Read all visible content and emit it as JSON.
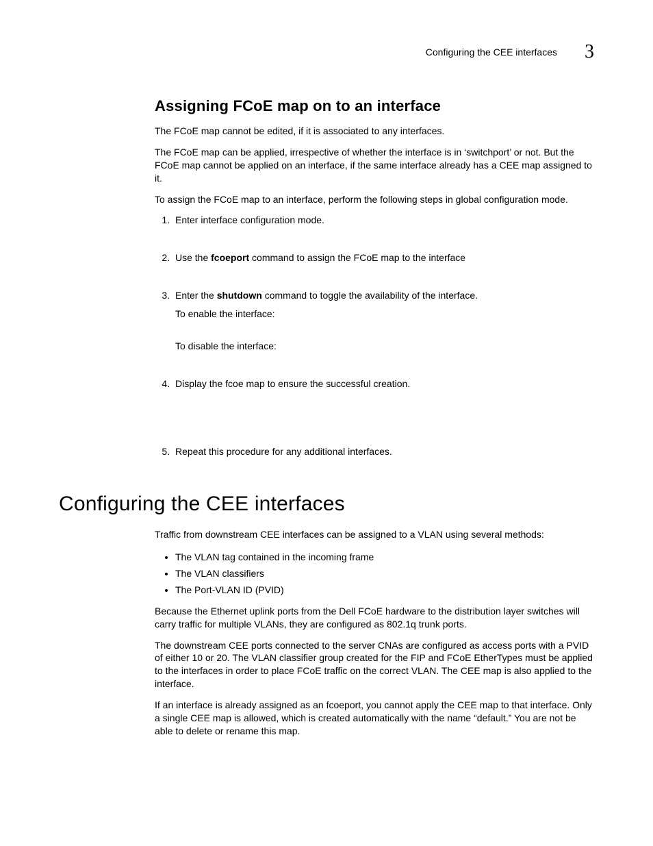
{
  "header": {
    "running_title": "Configuring the CEE interfaces",
    "chapter_number": "3"
  },
  "subsection": {
    "title": "Assigning FCoE map on to an interface",
    "p1": "The FCoE map cannot be edited, if it is associated to any interfaces.",
    "p2": "The FCoE map can be applied, irrespective of whether the interface is in ‘switchport’ or not. But the FCoE map cannot be applied on an interface, if the same interface already has a CEE map assigned to it.",
    "p3": "To assign the FCoE map to an interface, perform the following steps in global configuration mode.",
    "steps": [
      {
        "text": "Enter interface configuration mode."
      },
      {
        "prefix": "Use the ",
        "bold": "fcoeport",
        "suffix": " command to assign the FCoE map to the interface"
      },
      {
        "prefix": "Enter the ",
        "bold": "shutdown",
        "suffix": " command to toggle the availability of the interface.",
        "sub1": "To enable the interface:",
        "sub2": "To disable the interface:"
      },
      {
        "text": "Display the fcoe map to ensure the successful creation."
      },
      {
        "text": "Repeat this procedure for any additional interfaces."
      }
    ]
  },
  "section": {
    "title": "Configuring the CEE interfaces",
    "p1": "Traffic from downstream CEE interfaces can be assigned to a VLAN using several methods:",
    "bullets": [
      "The VLAN tag contained in the incoming frame",
      "The VLAN classifiers",
      "The Port-VLAN ID (PVID)"
    ],
    "p2": "Because the Ethernet uplink ports from the Dell FCoE hardware to the distribution layer switches will carry traffic for multiple VLANs, they are configured as 802.1q trunk ports.",
    "p3": "The downstream CEE ports connected to the server CNAs are configured as access ports with a PVID of either 10 or 20. The VLAN classifier group created for the FIP and FCoE EtherTypes must be applied to the interfaces in order to place FCoE traffic on the correct VLAN. The CEE map is also applied to the interface.",
    "p4": "If an interface is already assigned as an fcoeport, you cannot apply the CEE map to that interface. Only a single CEE map is allowed, which is created automatically with the name “default.” You are not be able to delete or rename this map."
  }
}
